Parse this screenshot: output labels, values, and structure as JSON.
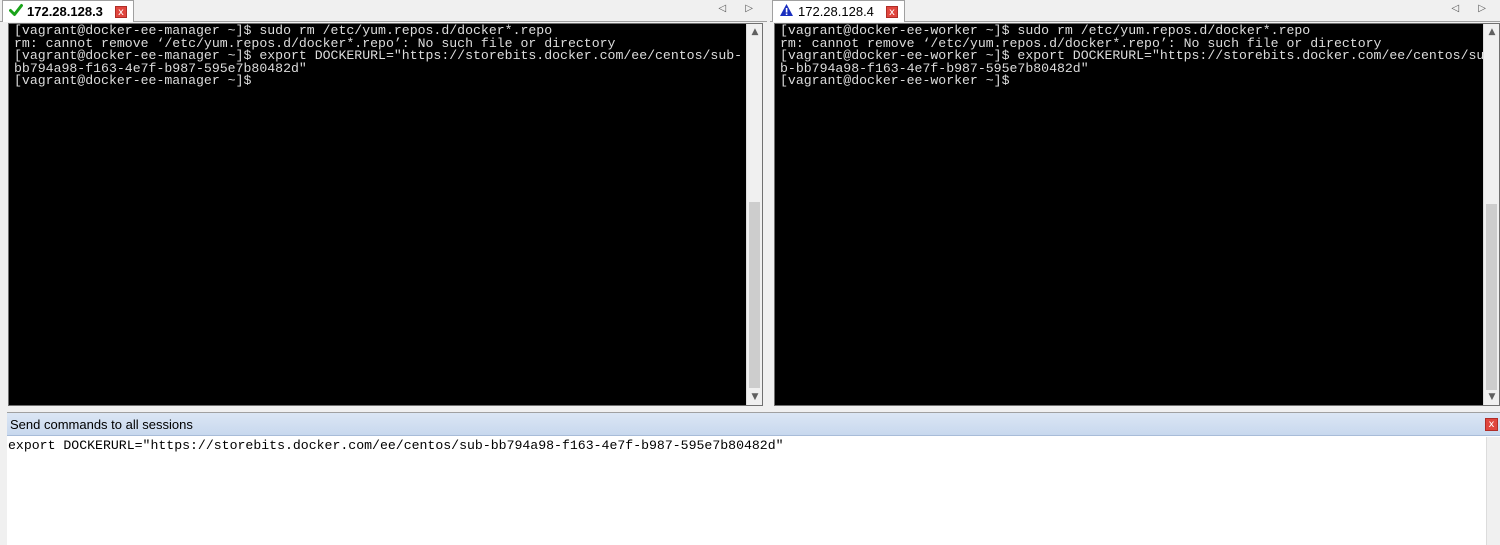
{
  "sessions": [
    {
      "tab_label": "172.28.128.3",
      "status_icon": "green-check-icon",
      "close_label": "x",
      "nav_label": "◁ ▷",
      "lines": [
        "[vagrant@docker-ee-manager ~]$ sudo rm /etc/yum.repos.d/docker*.repo",
        "rm: cannot remove ‘/etc/yum.repos.d/docker*.repo’: No such file or directory",
        "[vagrant@docker-ee-manager ~]$ export DOCKERURL=\"https://storebits.docker.com/ee/centos/sub-",
        "bb794a98-f163-4e7f-b987-595e7b80482d\"",
        "[vagrant@docker-ee-manager ~]$"
      ]
    },
    {
      "tab_label": "172.28.128.4",
      "status_icon": "warning-triangle-icon",
      "close_label": "x",
      "nav_label": "◁ ▷",
      "lines": [
        "[vagrant@docker-ee-worker ~]$ sudo rm /etc/yum.repos.d/docker*.repo",
        "rm: cannot remove ‘/etc/yum.repos.d/docker*.repo’: No such file or directory",
        "[vagrant@docker-ee-worker ~]$ export DOCKERURL=\"https://storebits.docker.com/ee/centos/su",
        "b-bb794a98-f163-4e7f-b987-595e7b80482d\"",
        "[vagrant@docker-ee-worker ~]$"
      ]
    }
  ],
  "send_panel": {
    "title": "Send commands to all sessions",
    "close_label": "x",
    "command": "export DOCKERURL=\"https://storebits.docker.com/ee/centos/sub-bb794a98-f163-4e7f-b987-595e7b80482d\""
  },
  "colors": {
    "check": "#1aa31a",
    "warning": "#1a2fbf",
    "terminal_bg": "#000000",
    "terminal_fg": "#dcdcdc",
    "header_bg": "#c8d8ee"
  }
}
